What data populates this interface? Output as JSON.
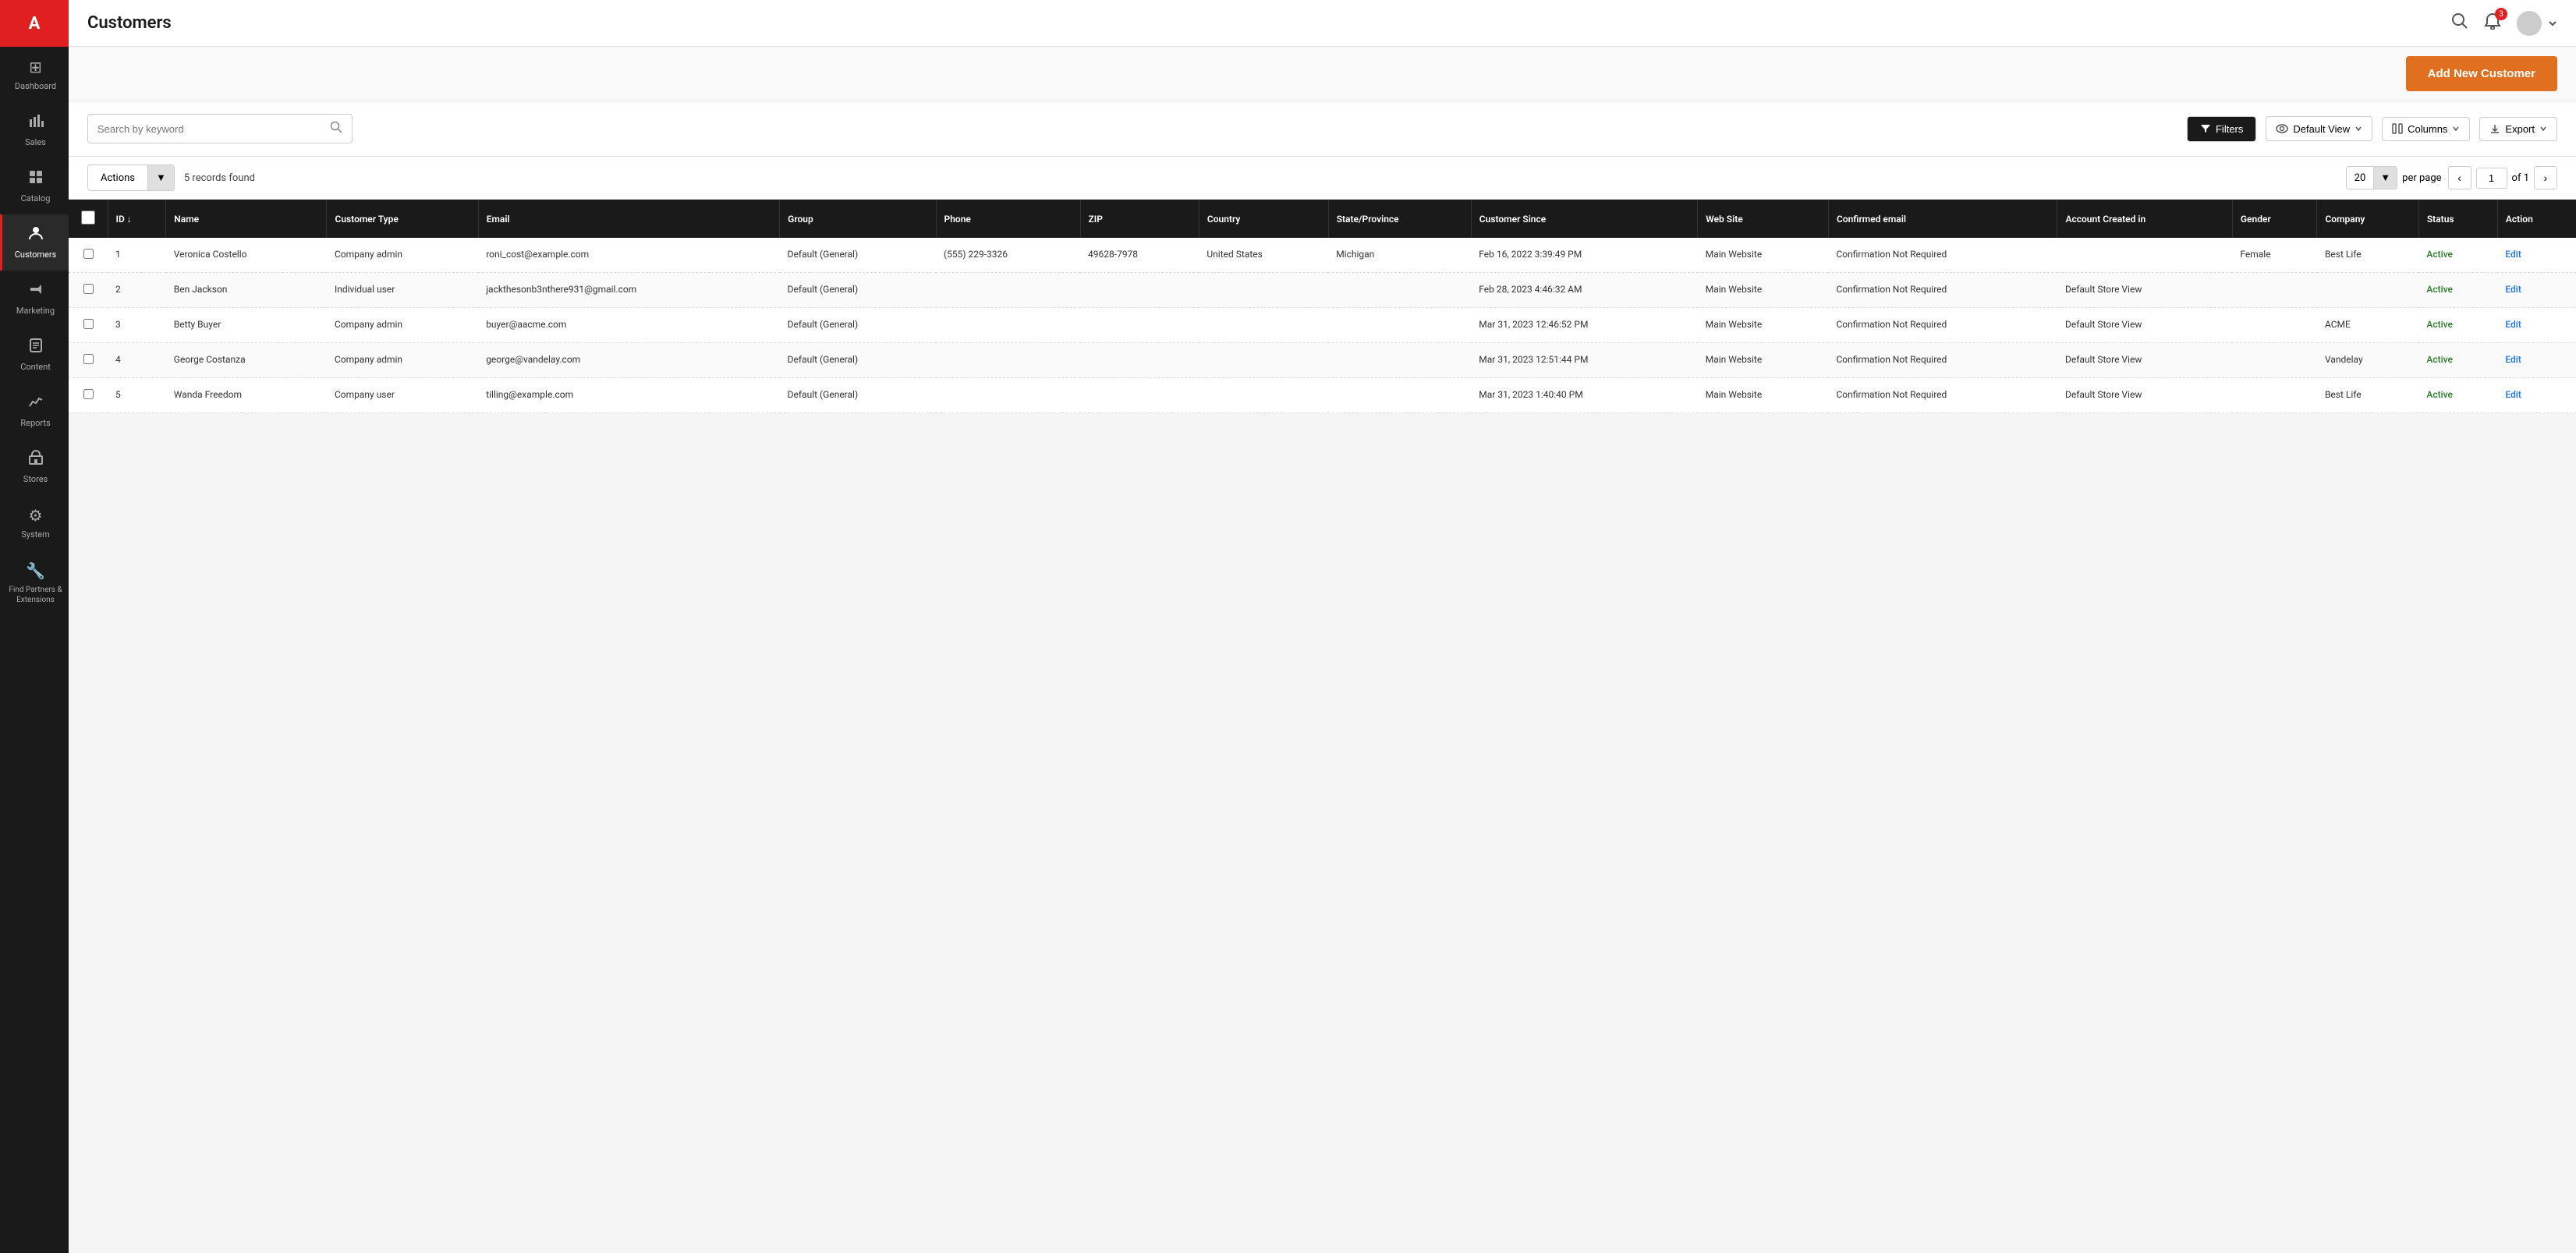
{
  "app": {
    "logo": "A",
    "title": "Customers"
  },
  "sidebar": {
    "items": [
      {
        "id": "dashboard",
        "label": "Dashboard",
        "icon": "⊞"
      },
      {
        "id": "sales",
        "label": "Sales",
        "icon": "📊"
      },
      {
        "id": "catalog",
        "label": "Catalog",
        "icon": "📦"
      },
      {
        "id": "customers",
        "label": "Customers",
        "icon": "👥"
      },
      {
        "id": "marketing",
        "label": "Marketing",
        "icon": "📢"
      },
      {
        "id": "content",
        "label": "Content",
        "icon": "📄"
      },
      {
        "id": "reports",
        "label": "Reports",
        "icon": "📈"
      },
      {
        "id": "stores",
        "label": "Stores",
        "icon": "🏪"
      },
      {
        "id": "system",
        "label": "System",
        "icon": "⚙"
      },
      {
        "id": "find-partners",
        "label": "Find Partners & Extensions",
        "icon": "🔧"
      }
    ]
  },
  "topbar": {
    "title": "Customers",
    "notification_count": "3",
    "user_name": ""
  },
  "banner": {
    "add_button_label": "Add New Customer"
  },
  "filters": {
    "search_placeholder": "Search by keyword",
    "filters_label": "Filters",
    "default_view_label": "Default View",
    "columns_label": "Columns",
    "export_label": "Export"
  },
  "table_controls": {
    "actions_label": "Actions",
    "records_count": "5 records found",
    "per_page_value": "20",
    "per_page_label": "per page",
    "page_current": "1",
    "page_total": "of 1"
  },
  "table": {
    "columns": [
      {
        "key": "checkbox",
        "label": ""
      },
      {
        "key": "id",
        "label": "ID ↓"
      },
      {
        "key": "name",
        "label": "Name"
      },
      {
        "key": "customer_type",
        "label": "Customer Type"
      },
      {
        "key": "email",
        "label": "Email"
      },
      {
        "key": "group",
        "label": "Group"
      },
      {
        "key": "phone",
        "label": "Phone"
      },
      {
        "key": "zip",
        "label": "ZIP"
      },
      {
        "key": "country",
        "label": "Country"
      },
      {
        "key": "state",
        "label": "State/Province"
      },
      {
        "key": "customer_since",
        "label": "Customer Since"
      },
      {
        "key": "website",
        "label": "Web Site"
      },
      {
        "key": "confirmed_email",
        "label": "Confirmed email"
      },
      {
        "key": "account_created_in",
        "label": "Account Created in"
      },
      {
        "key": "gender",
        "label": "Gender"
      },
      {
        "key": "company",
        "label": "Company"
      },
      {
        "key": "status",
        "label": "Status"
      },
      {
        "key": "action",
        "label": "Action"
      }
    ],
    "rows": [
      {
        "id": "1",
        "name": "Veronica Costello",
        "customer_type": "Company admin",
        "email": "roni_cost@example.com",
        "group": "Default (General)",
        "phone": "(555) 229-3326",
        "zip": "49628-7978",
        "country": "United States",
        "state": "Michigan",
        "customer_since": "Feb 16, 2022 3:39:49 PM",
        "website": "Main Website",
        "confirmed_email": "Confirmation Not Required",
        "account_created_in": "",
        "gender": "Female",
        "company": "Best Life",
        "status": "Active",
        "action": "Edit"
      },
      {
        "id": "2",
        "name": "Ben Jackson",
        "customer_type": "Individual user",
        "email": "jackthesonb3nthere931@gmail.com",
        "group": "Default (General)",
        "phone": "",
        "zip": "",
        "country": "",
        "state": "",
        "customer_since": "Feb 28, 2023 4:46:32 AM",
        "website": "Main Website",
        "confirmed_email": "Confirmation Not Required",
        "account_created_in": "Default Store View",
        "gender": "",
        "company": "",
        "status": "Active",
        "action": "Edit"
      },
      {
        "id": "3",
        "name": "Betty Buyer",
        "customer_type": "Company admin",
        "email": "buyer@aacme.com",
        "group": "Default (General)",
        "phone": "",
        "zip": "",
        "country": "",
        "state": "",
        "customer_since": "Mar 31, 2023 12:46:52 PM",
        "website": "Main Website",
        "confirmed_email": "Confirmation Not Required",
        "account_created_in": "Default Store View",
        "gender": "",
        "company": "ACME",
        "status": "Active",
        "action": "Edit"
      },
      {
        "id": "4",
        "name": "George Costanza",
        "customer_type": "Company admin",
        "email": "george@vandelay.com",
        "group": "Default (General)",
        "phone": "",
        "zip": "",
        "country": "",
        "state": "",
        "customer_since": "Mar 31, 2023 12:51:44 PM",
        "website": "Main Website",
        "confirmed_email": "Confirmation Not Required",
        "account_created_in": "Default Store View",
        "gender": "",
        "company": "Vandelay",
        "status": "Active",
        "action": "Edit"
      },
      {
        "id": "5",
        "name": "Wanda Freedom",
        "customer_type": "Company user",
        "email": "tilling@example.com",
        "group": "Default (General)",
        "phone": "",
        "zip": "",
        "country": "",
        "state": "",
        "customer_since": "Mar 31, 2023 1:40:40 PM",
        "website": "Main Website",
        "confirmed_email": "Confirmation Not Required",
        "account_created_in": "Default Store View",
        "gender": "",
        "company": "Best Life",
        "status": "Active",
        "action": "Edit"
      }
    ]
  }
}
